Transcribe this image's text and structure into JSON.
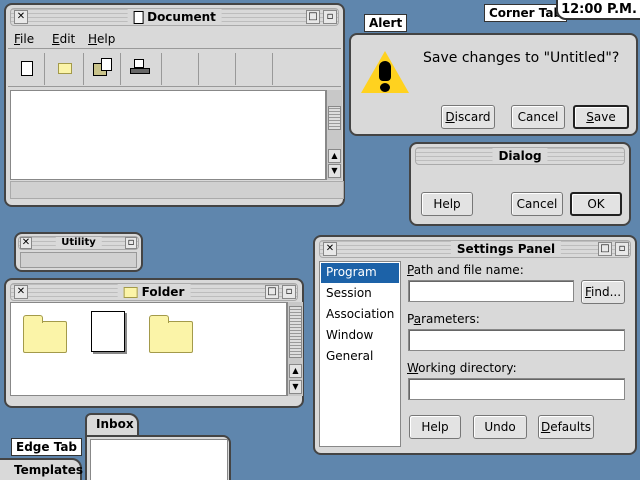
{
  "clock": "12:00 P.M.",
  "corner_tab": "Corner Tab",
  "document": {
    "title": "Document",
    "menu": [
      "File",
      "Edit",
      "Help"
    ]
  },
  "alert": {
    "tab": "Alert",
    "message": "Save changes to \"Untitled\"?",
    "buttons": {
      "discard": "Discard",
      "cancel": "Cancel",
      "save": "Save"
    }
  },
  "dialog": {
    "title": "Dialog",
    "buttons": {
      "help": "Help",
      "cancel": "Cancel",
      "ok": "OK"
    }
  },
  "utility": {
    "title": "Utility"
  },
  "folder": {
    "title": "Folder"
  },
  "settings": {
    "title": "Settings Panel",
    "sidebar": [
      "Program",
      "Session",
      "Association",
      "Window",
      "General"
    ],
    "path_label": "Path and file name:",
    "find_button": "Find...",
    "params_label": "Parameters:",
    "workdir_label": "Working directory:",
    "buttons": {
      "help": "Help",
      "undo": "Undo",
      "defaults": "Defaults"
    }
  },
  "edge_tab": "Edge Tab",
  "templates_tab": "Templates",
  "inbox_tab": "Inbox"
}
